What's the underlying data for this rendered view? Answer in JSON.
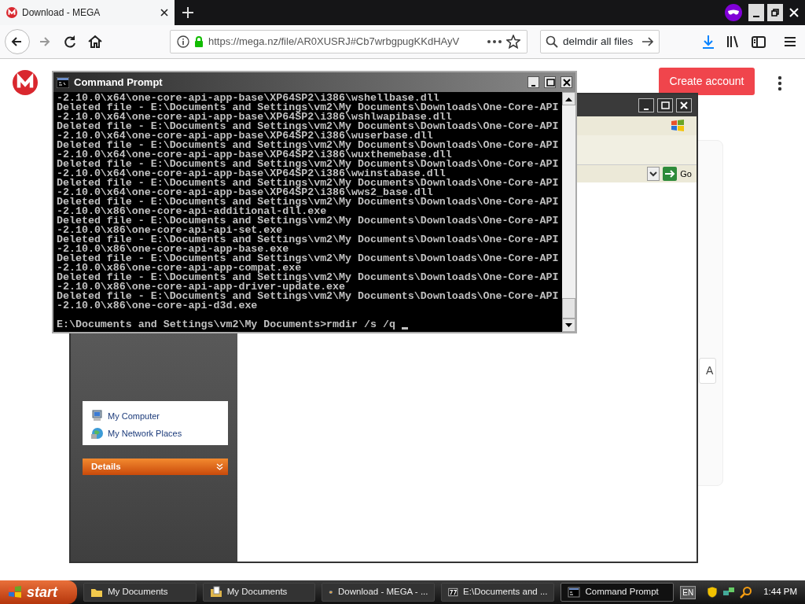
{
  "browser": {
    "tab": {
      "title": "Download - MEGA",
      "selected": true
    },
    "url": "https://mega.nz/file/AR0XUSRJ#Cb7wrbgpugKKdHAyV",
    "search": "delmdir all files"
  },
  "page": {
    "create_account": "Create account",
    "side_button": "A"
  },
  "explorer": {
    "go": "Go",
    "places": [
      {
        "label": "My Computer",
        "kind": "computer"
      },
      {
        "label": "My Network Places",
        "kind": "network"
      }
    ],
    "details": "Details"
  },
  "cmd": {
    "title": "Command Prompt",
    "lines": [
      "-2.10.0\\x64\\one-core-api-app-base\\XP64SP2\\i386\\wshellbase.dll",
      "Deleted file - E:\\Documents and Settings\\vm2\\My Documents\\Downloads\\One-Core-API",
      "-2.10.0\\x64\\one-core-api-app-base\\XP64SP2\\i386\\wshlwapibase.dll",
      "Deleted file - E:\\Documents and Settings\\vm2\\My Documents\\Downloads\\One-Core-API",
      "-2.10.0\\x64\\one-core-api-app-base\\XP64SP2\\i386\\wuserbase.dll",
      "Deleted file - E:\\Documents and Settings\\vm2\\My Documents\\Downloads\\One-Core-API",
      "-2.10.0\\x64\\one-core-api-app-base\\XP64SP2\\i386\\wuxthemebase.dll",
      "Deleted file - E:\\Documents and Settings\\vm2\\My Documents\\Downloads\\One-Core-API",
      "-2.10.0\\x64\\one-core-api-app-base\\XP64SP2\\i386\\wwinstabase.dll",
      "Deleted file - E:\\Documents and Settings\\vm2\\My Documents\\Downloads\\One-Core-API",
      "-2.10.0\\x64\\one-core-api-app-base\\XP64SP2\\i386\\wws2_base.dll",
      "Deleted file - E:\\Documents and Settings\\vm2\\My Documents\\Downloads\\One-Core-API",
      "-2.10.0\\x86\\one-core-api-additional-dll.exe",
      "Deleted file - E:\\Documents and Settings\\vm2\\My Documents\\Downloads\\One-Core-API",
      "-2.10.0\\x86\\one-core-api-api-set.exe",
      "Deleted file - E:\\Documents and Settings\\vm2\\My Documents\\Downloads\\One-Core-API",
      "-2.10.0\\x86\\one-core-api-app-base.exe",
      "Deleted file - E:\\Documents and Settings\\vm2\\My Documents\\Downloads\\One-Core-API",
      "-2.10.0\\x86\\one-core-api-app-compat.exe",
      "Deleted file - E:\\Documents and Settings\\vm2\\My Documents\\Downloads\\One-Core-API",
      "-2.10.0\\x86\\one-core-api-app-driver-update.exe",
      "Deleted file - E:\\Documents and Settings\\vm2\\My Documents\\Downloads\\One-Core-API",
      "-2.10.0\\x86\\one-core-api-d3d.exe"
    ],
    "prompt": "E:\\Documents and Settings\\vm2\\My Documents>rmdir /s /q"
  },
  "taskbar": {
    "start": "start",
    "items": [
      {
        "label": "My Documents",
        "kind": "folder",
        "selected": false
      },
      {
        "label": "My Documents",
        "kind": "document",
        "selected": false
      },
      {
        "label": "Download - MEGA - ...",
        "kind": "browser",
        "selected": false
      },
      {
        "label": "E:\\Documents and ...",
        "kind": "archive",
        "selected": false
      },
      {
        "label": "Command Prompt",
        "kind": "console",
        "selected": true
      }
    ],
    "language": "EN",
    "clock": "1:44 PM"
  }
}
